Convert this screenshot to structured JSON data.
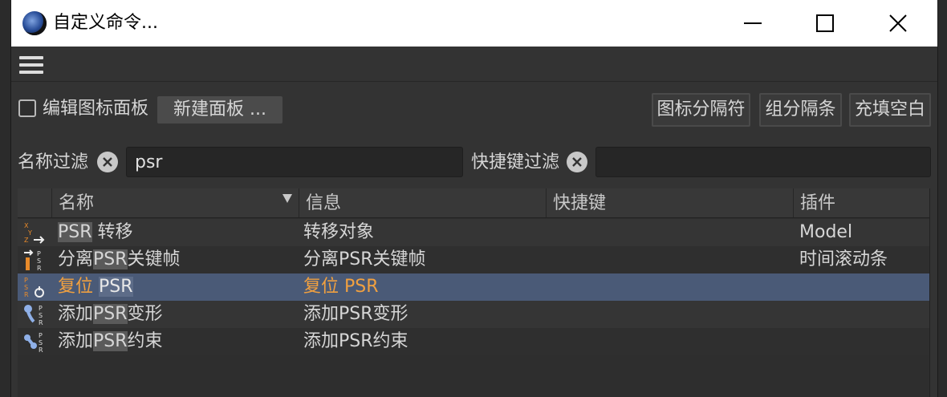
{
  "window": {
    "title": "自定义命令..."
  },
  "toolbar": {
    "edit_panel_label": "编辑图标面板",
    "new_panel_button": "新建面板 ...",
    "icon_separator_button": "图标分隔符",
    "group_separator_button": "组分隔条",
    "fill_space_button": "充填空白"
  },
  "filters": {
    "name_filter_label": "名称过滤",
    "name_filter_value": "psr",
    "shortcut_filter_label": "快捷键过滤",
    "shortcut_filter_value": ""
  },
  "table": {
    "columns": [
      "名称",
      "信息",
      "快捷键",
      "插件"
    ],
    "rows": [
      {
        "name_match": "PSR",
        "name_rest": " 转移",
        "info": "转移对象",
        "shortcut": "",
        "plugin": "Model",
        "icon": "xyz-transfer-icon"
      },
      {
        "name_pre": "分离",
        "name_match": "PSR",
        "name_rest": "关键帧",
        "info": "分离PSR关键帧",
        "shortcut": "",
        "plugin": "时间滚动条",
        "icon": "separate-psr-key-icon"
      },
      {
        "name_pre": "复位 ",
        "name_match": "PSR",
        "name_rest": "",
        "info": "复位 PSR",
        "shortcut": "",
        "plugin": "",
        "icon": "reset-psr-icon",
        "selected": true
      },
      {
        "name_pre": "添加",
        "name_match": "PSR",
        "name_rest": "变形",
        "info": "添加PSR变形",
        "shortcut": "",
        "plugin": "",
        "icon": "add-psr-deformer-icon"
      },
      {
        "name_pre": "添加",
        "name_match": "PSR",
        "name_rest": "约束",
        "info": "添加PSR约束",
        "shortcut": "",
        "plugin": "",
        "icon": "add-psr-constraint-icon"
      }
    ]
  },
  "colors": {
    "selected_row": "#4a5a77",
    "selected_text": "#f0a040"
  }
}
